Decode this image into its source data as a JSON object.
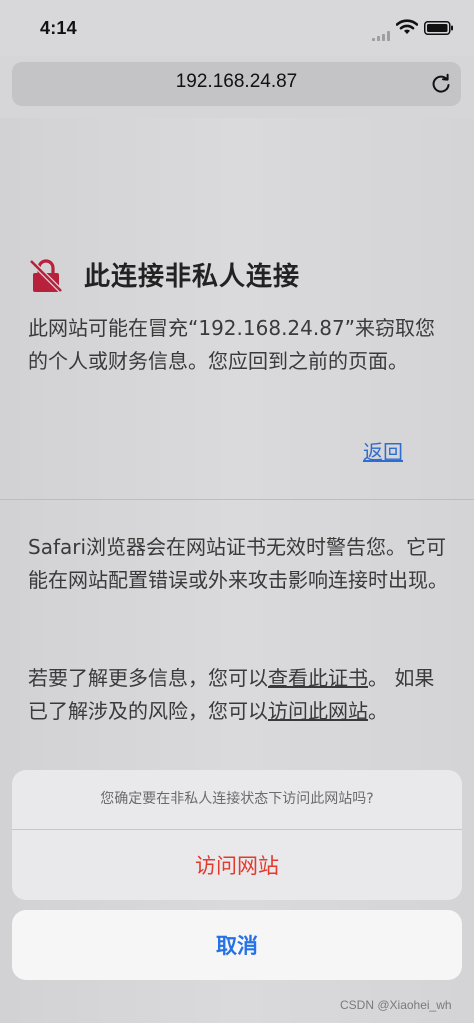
{
  "status_bar": {
    "time": "4:14",
    "icons": [
      "signal-icon",
      "wifi-icon",
      "battery-icon"
    ]
  },
  "url_bar": {
    "url": "192.168.24.87",
    "reload_icon": "reload-icon"
  },
  "warning": {
    "icon": "warning-icon",
    "title": "此连接非私人连接",
    "body": "此网站可能在冒充“192.168.24.87”来窃取您的个人或财务信息。您应回到之前的页面。",
    "back_link": "返回"
  },
  "details": {
    "paragraph1": "Safari浏览器会在网站证书无效时警告您。它可能在网站配置错误或外来攻击影响连接时出现。",
    "paragraph2_prefix": "若要了解更多信息，您可以",
    "view_certificate_link": "查看此证书",
    "paragraph2_middle": "。 如果已了解涉及的风险，您可以",
    "visit_site_link": "访问此网站",
    "paragraph2_suffix": "。"
  },
  "action_sheet": {
    "message": "您确定要在非私人连接状态下访问此网站吗?",
    "visit_button": "访问网站",
    "cancel_button": "取消"
  },
  "watermark": "CSDN @Xiaohei_wh",
  "colors": {
    "link_blue": "#2f6cd1",
    "destructive_red": "#e33a2e",
    "cancel_blue": "#2472e5",
    "warning_icon_red": "#b8213c"
  }
}
